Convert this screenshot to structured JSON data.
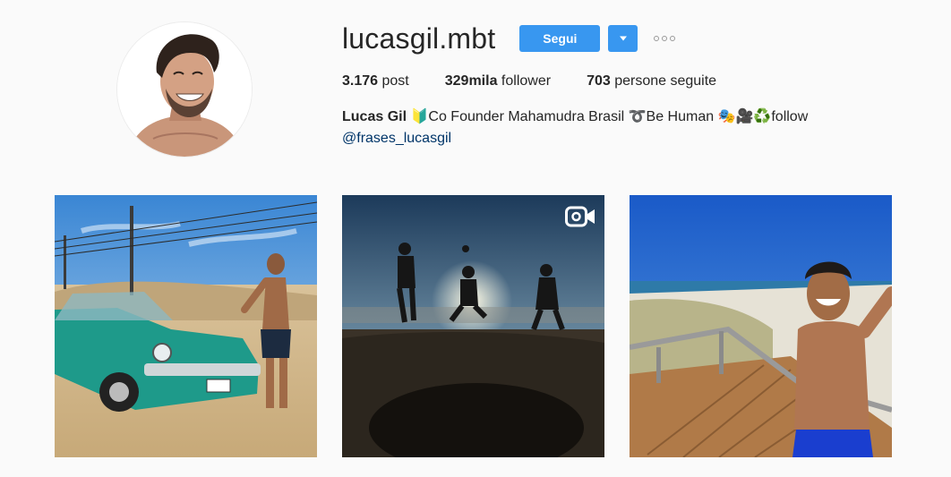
{
  "profile": {
    "username": "lucasgil.mbt",
    "follow_label": "Segui",
    "stats": {
      "posts_count": "3.176",
      "posts_label": "post",
      "followers_count": "329mila",
      "followers_label": "follower",
      "following_count": "703",
      "following_label": "persone seguite"
    },
    "bio": {
      "name": "Lucas Gil",
      "text": "🔰Co Founder Mahamudra Brasil ➰Be Human 🎭🎥♻️follow",
      "link": "@frases_lucasgil"
    }
  },
  "posts": [
    {
      "subject": "green vintage car on beach with man",
      "is_video": false
    },
    {
      "subject": "silhouettes playing football at sunset",
      "is_video": true
    },
    {
      "subject": "man selfie on beach boardwalk",
      "is_video": false
    }
  ],
  "colors": {
    "accent": "#3897f0",
    "link": "#003569",
    "background": "#fafafa",
    "text": "#262626"
  },
  "icons": {
    "dropdown": "caret-down-icon",
    "more": "more-options-icon",
    "video": "video-camera-icon"
  }
}
